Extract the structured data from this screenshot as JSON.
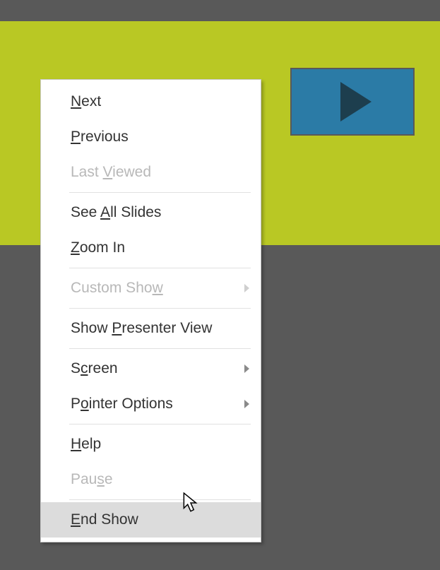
{
  "slide": {
    "play_button": "play"
  },
  "menu": {
    "items": [
      {
        "pre": "",
        "accel": "N",
        "post": "ext",
        "enabled": true,
        "submenu": false,
        "separatorAfter": false
      },
      {
        "pre": "",
        "accel": "P",
        "post": "revious",
        "enabled": true,
        "submenu": false,
        "separatorAfter": false
      },
      {
        "pre": "Last ",
        "accel": "V",
        "post": "iewed",
        "enabled": false,
        "submenu": false,
        "separatorAfter": true
      },
      {
        "pre": "See ",
        "accel": "A",
        "post": "ll Slides",
        "enabled": true,
        "submenu": false,
        "separatorAfter": false
      },
      {
        "pre": "",
        "accel": "Z",
        "post": "oom In",
        "enabled": true,
        "submenu": false,
        "separatorAfter": true
      },
      {
        "pre": "Custom Sho",
        "accel": "w",
        "post": "",
        "enabled": false,
        "submenu": true,
        "separatorAfter": true
      },
      {
        "pre": "Show ",
        "accel": "P",
        "post": "resenter View",
        "enabled": true,
        "submenu": false,
        "separatorAfter": true
      },
      {
        "pre": "S",
        "accel": "c",
        "post": "reen",
        "enabled": true,
        "submenu": true,
        "separatorAfter": false
      },
      {
        "pre": "P",
        "accel": "o",
        "post": "inter Options",
        "enabled": true,
        "submenu": true,
        "separatorAfter": true
      },
      {
        "pre": "",
        "accel": "H",
        "post": "elp",
        "enabled": true,
        "submenu": false,
        "separatorAfter": false
      },
      {
        "pre": "Pau",
        "accel": "s",
        "post": "e",
        "enabled": false,
        "submenu": false,
        "separatorAfter": true
      },
      {
        "pre": "",
        "accel": "E",
        "post": "nd Show",
        "enabled": true,
        "submenu": false,
        "separatorAfter": false
      }
    ],
    "hoveredIndex": 11
  }
}
